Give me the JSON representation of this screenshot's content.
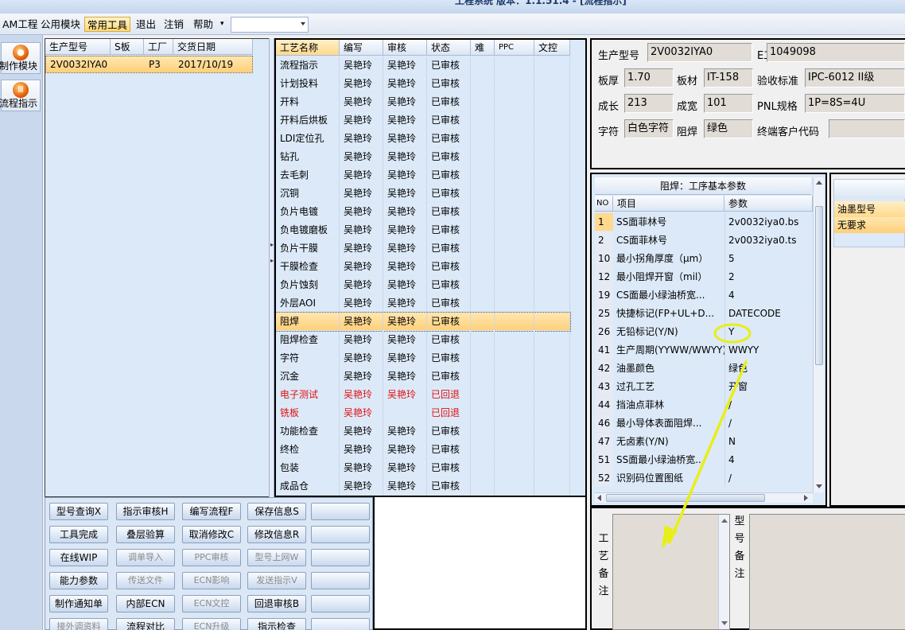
{
  "window": {
    "title": "工程系统 版本：1.1.51.4 - [流程指示]"
  },
  "menu": {
    "items": [
      "AM工程",
      "公用模块",
      "常用工具",
      "退出",
      "注销",
      "帮助"
    ],
    "active_index": 2
  },
  "launcher": [
    {
      "label": "制作模块",
      "icon": "fire-icon"
    },
    {
      "label": "流程指示",
      "icon": "flow-icon"
    }
  ],
  "models": {
    "headers": [
      "生产型号",
      "S板",
      "工厂",
      "交货日期"
    ],
    "rows": [
      {
        "model": "2V0032IYA0",
        "s": "",
        "factory": "P3",
        "date": "2017/10/19"
      }
    ]
  },
  "processes": {
    "headers": [
      "工艺名称",
      "编写",
      "审核",
      "状态",
      "难",
      "PPC",
      "文控"
    ],
    "selected_index": 14,
    "rows": [
      {
        "name": "流程指示",
        "writer": "吴艳玲",
        "reviewer": "吴艳玲",
        "status": "已审核",
        "red": false
      },
      {
        "name": "计划投料",
        "writer": "吴艳玲",
        "reviewer": "吴艳玲",
        "status": "已审核",
        "red": false
      },
      {
        "name": "开料",
        "writer": "吴艳玲",
        "reviewer": "吴艳玲",
        "status": "已审核",
        "red": false
      },
      {
        "name": "开料后烘板",
        "writer": "吴艳玲",
        "reviewer": "吴艳玲",
        "status": "已审核",
        "red": false
      },
      {
        "name": "LDI定位孔",
        "writer": "吴艳玲",
        "reviewer": "吴艳玲",
        "status": "已审核",
        "red": false
      },
      {
        "name": "钻孔",
        "writer": "吴艳玲",
        "reviewer": "吴艳玲",
        "status": "已审核",
        "red": false
      },
      {
        "name": "去毛刺",
        "writer": "吴艳玲",
        "reviewer": "吴艳玲",
        "status": "已审核",
        "red": false
      },
      {
        "name": "沉铜",
        "writer": "吴艳玲",
        "reviewer": "吴艳玲",
        "status": "已审核",
        "red": false
      },
      {
        "name": "负片电镀",
        "writer": "吴艳玲",
        "reviewer": "吴艳玲",
        "status": "已审核",
        "red": false
      },
      {
        "name": "负电镀磨板",
        "writer": "吴艳玲",
        "reviewer": "吴艳玲",
        "status": "已审核",
        "red": false
      },
      {
        "name": "负片干膜",
        "writer": "吴艳玲",
        "reviewer": "吴艳玲",
        "status": "已审核",
        "red": false
      },
      {
        "name": "干膜检查",
        "writer": "吴艳玲",
        "reviewer": "吴艳玲",
        "status": "已审核",
        "red": false
      },
      {
        "name": "负片蚀刻",
        "writer": "吴艳玲",
        "reviewer": "吴艳玲",
        "status": "已审核",
        "red": false
      },
      {
        "name": "外层AOI",
        "writer": "吴艳玲",
        "reviewer": "吴艳玲",
        "status": "已审核",
        "red": false
      },
      {
        "name": "阻焊",
        "writer": "吴艳玲",
        "reviewer": "吴艳玲",
        "status": "已审核",
        "red": false
      },
      {
        "name": "阻焊检查",
        "writer": "吴艳玲",
        "reviewer": "吴艳玲",
        "status": "已审核",
        "red": false
      },
      {
        "name": "字符",
        "writer": "吴艳玲",
        "reviewer": "吴艳玲",
        "status": "已审核",
        "red": false
      },
      {
        "name": "沉金",
        "writer": "吴艳玲",
        "reviewer": "吴艳玲",
        "status": "已审核",
        "red": false
      },
      {
        "name": "电子测试",
        "writer": "吴艳玲",
        "reviewer": "吴艳玲",
        "status": "已回退",
        "red": true
      },
      {
        "name": "铣板",
        "writer": "吴艳玲",
        "reviewer": "",
        "status": "已回退",
        "red": true
      },
      {
        "name": "功能检查",
        "writer": "吴艳玲",
        "reviewer": "吴艳玲",
        "status": "已审核",
        "red": false
      },
      {
        "name": "终检",
        "writer": "吴艳玲",
        "reviewer": "吴艳玲",
        "status": "已审核",
        "red": false
      },
      {
        "name": "包装",
        "writer": "吴艳玲",
        "reviewer": "吴艳玲",
        "status": "已审核",
        "red": false
      },
      {
        "name": "成品仓",
        "writer": "吴艳玲",
        "reviewer": "吴艳玲",
        "status": "已审核",
        "red": false
      }
    ]
  },
  "buttons": [
    [
      {
        "label": "型号查询X",
        "enabled": true
      },
      {
        "label": "指示审核H",
        "enabled": true
      },
      {
        "label": "编写流程F",
        "enabled": true
      },
      {
        "label": "保存信息S",
        "enabled": true
      },
      {
        "label": "",
        "enabled": true
      }
    ],
    [
      {
        "label": "工具完成",
        "enabled": true
      },
      {
        "label": "叠层验算",
        "enabled": true
      },
      {
        "label": "取消修改C",
        "enabled": true
      },
      {
        "label": "修改信息R",
        "enabled": true
      },
      {
        "label": "",
        "enabled": true
      }
    ],
    [
      {
        "label": "在线WIP",
        "enabled": true
      },
      {
        "label": "调单导入",
        "enabled": false
      },
      {
        "label": "PPC审核",
        "enabled": false
      },
      {
        "label": "型号上网W",
        "enabled": false
      },
      {
        "label": "",
        "enabled": true
      }
    ],
    [
      {
        "label": "能力参数",
        "enabled": true
      },
      {
        "label": "传送文件",
        "enabled": false
      },
      {
        "label": "ECN影响",
        "enabled": false
      },
      {
        "label": "发送指示V",
        "enabled": false
      },
      {
        "label": "",
        "enabled": true
      }
    ],
    [
      {
        "label": "制作通知单",
        "enabled": true
      },
      {
        "label": "内部ECN",
        "enabled": true
      },
      {
        "label": "ECN文控",
        "enabled": false
      },
      {
        "label": "回退审核B",
        "enabled": true
      },
      {
        "label": "",
        "enabled": true
      }
    ],
    [
      {
        "label": "接外调资料",
        "enabled": false
      },
      {
        "label": "流程对比",
        "enabled": true
      },
      {
        "label": "ECN升级",
        "enabled": false
      },
      {
        "label": "指示检查",
        "enabled": true
      },
      {
        "label": "",
        "enabled": true
      }
    ]
  ],
  "info": {
    "model_label": "生产型号",
    "model_value": "2V0032IYA0",
    "e_label": "E工号",
    "e_value": "1049098",
    "thickness_label": "板厚",
    "thickness_value": "1.70",
    "material_label": "板材",
    "material_value": "IT-158",
    "standard_label": "验收标准",
    "standard_value": "IPC-6012 II级",
    "length_label": "成长",
    "length_value": "213",
    "width_label": "成宽",
    "width_value": "101",
    "pnl_label": "PNL规格",
    "pnl_value": "1P=8S=4U",
    "char_label": "字符",
    "char_value": "白色字符",
    "mask_label": "阻焊",
    "mask_value": "绿色",
    "customer_label": "终端客户代码",
    "customer_value": ""
  },
  "params": {
    "title": "阻焊：工序基本参数",
    "headers": [
      "NO",
      "项目",
      "参数"
    ],
    "rows": [
      {
        "no": "1",
        "item": "SS面菲林号",
        "value": "2v0032iya0.bs"
      },
      {
        "no": "2",
        "item": "CS面菲林号",
        "value": "2v0032iya0.ts"
      },
      {
        "no": "10",
        "item": "最小拐角厚度（μm）",
        "value": "5"
      },
      {
        "no": "12",
        "item": "最小阻焊开窗（mil）",
        "value": "2"
      },
      {
        "no": "19",
        "item": "CS面最小绿油桥宽...",
        "value": "4"
      },
      {
        "no": "25",
        "item": "快捷标记(FP+UL+D...",
        "value": "DATECODE"
      },
      {
        "no": "26",
        "item": "无铅标记(Y/N)",
        "value": "Y"
      },
      {
        "no": "41",
        "item": "生产周期(YYWW/WWYY)",
        "value": "WWYY"
      },
      {
        "no": "42",
        "item": "油墨颜色",
        "value": "绿色"
      },
      {
        "no": "43",
        "item": "过孔工艺",
        "value": "开窗"
      },
      {
        "no": "44",
        "item": "挡油点菲林",
        "value": "/"
      },
      {
        "no": "46",
        "item": "最小导体表面阻焊...",
        "value": "/"
      },
      {
        "no": "47",
        "item": "无卤素(Y/N)",
        "value": "N"
      },
      {
        "no": "51",
        "item": "SS面最小绿油桥宽...",
        "value": "4"
      },
      {
        "no": "52",
        "item": "识别码位置图纸",
        "value": "/"
      }
    ]
  },
  "ink": {
    "header": "油墨型号",
    "value": "无要求"
  },
  "notes": {
    "process_label": "工艺备注",
    "model_label": "型号备注"
  },
  "annotation": {
    "color": "#e8ee1a"
  }
}
